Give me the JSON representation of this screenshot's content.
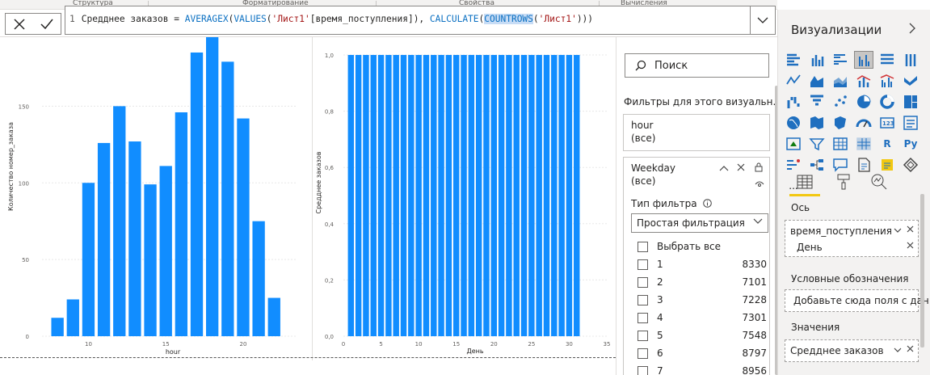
{
  "ribbon": {
    "sections": [
      "Структура",
      "Форматирование",
      "Свойства",
      "Вычисления"
    ]
  },
  "formula": {
    "line_number": "1",
    "part_measure": "Средднее заказов = ",
    "part_fn1": "AVERAGEX",
    "part_p1": "(",
    "part_fn2": "VALUES",
    "part_p2": "(",
    "part_str1": "'Лист1'",
    "part_col": "[время_поступления]",
    "part_p3": "), ",
    "part_fn3": "CALCULATE",
    "part_p4": "(",
    "part_fn4": "COUNTROWS",
    "part_p5": "(",
    "part_str2": "'Лист1'",
    "part_p6": ")))",
    "cancel_icon": "close-icon",
    "commit_icon": "check-icon"
  },
  "charts": [],
  "chart_data": [
    {
      "type": "bar",
      "xlabel": "hour",
      "ylabel": "Количество номер_заказа",
      "x": [
        8,
        9,
        10,
        11,
        12,
        13,
        14,
        15,
        16,
        17,
        18,
        19,
        20,
        21,
        22,
        23
      ],
      "values": [
        12,
        24,
        100,
        126,
        150,
        127,
        99,
        111,
        146,
        185,
        210,
        179,
        142,
        75,
        25,
        0
      ],
      "x_ticks": [
        "10",
        "15",
        "20"
      ],
      "y_ticks": [
        "0",
        "50",
        "100",
        "150"
      ],
      "ylim": [
        0,
        195
      ],
      "bar_color": "#118dff",
      "grid": true
    },
    {
      "type": "bar",
      "xlabel": "День",
      "ylabel": "Средднее заказов",
      "x": [
        1,
        2,
        3,
        4,
        5,
        6,
        7,
        8,
        9,
        10,
        11,
        12,
        13,
        14,
        15,
        16,
        17,
        18,
        19,
        20,
        21,
        22,
        23,
        24,
        25,
        26,
        27,
        28,
        29,
        30,
        31
      ],
      "values": [
        1.0,
        1.0,
        1.0,
        1.0,
        1.0,
        1.0,
        1.0,
        1.0,
        1.0,
        1.0,
        1.0,
        1.0,
        1.0,
        1.0,
        1.0,
        1.0,
        1.0,
        1.0,
        1.0,
        1.0,
        1.0,
        1.0,
        1.0,
        1.0,
        1.0,
        1.0,
        1.0,
        1.0,
        1.0,
        1.0,
        1.0
      ],
      "x_ticks": [
        "0",
        "5",
        "10",
        "15",
        "20",
        "25",
        "30",
        "35"
      ],
      "y_ticks": [
        "0,0",
        "0,2",
        "0,4",
        "0,6",
        "0,8",
        "1,0"
      ],
      "xlim": [
        0,
        35
      ],
      "ylim": [
        0,
        1.0
      ],
      "bar_color": "#118dff",
      "grid": true
    }
  ],
  "filters": {
    "search_placeholder": "Поиск",
    "title": "Фильтры для этого визуальн...",
    "hour_card": {
      "name": "hour",
      "value": "(все)"
    },
    "weekday_card": {
      "name": "Weekday",
      "value": "(все)",
      "filter_type_label": "Тип фильтра",
      "filter_type_value": "Простая фильтрация",
      "select_all": "Выбрать все",
      "items": [
        {
          "label": "1",
          "count": "8330"
        },
        {
          "label": "2",
          "count": "7101"
        },
        {
          "label": "3",
          "count": "7228"
        },
        {
          "label": "4",
          "count": "7301"
        },
        {
          "label": "5",
          "count": "7548"
        },
        {
          "label": "6",
          "count": "8797"
        },
        {
          "label": "7",
          "count": "8956"
        }
      ]
    }
  },
  "visualizations": {
    "title": "Визуализации",
    "custom_labels": {
      "r": "R",
      "py": "Py",
      "more": "..."
    },
    "axis_label": "Ось",
    "axis_fields": [
      "время_поступления",
      "День"
    ],
    "legend_label": "Условные обозначения",
    "legend_placeholder": "Добавьте сюда поля с дан...",
    "values_label": "Значения",
    "values_field": "Средднее заказов"
  },
  "colors": {
    "accent": "#118dff",
    "tab_underline": "#f2c811",
    "pane_bg": "#f3f2f1"
  }
}
